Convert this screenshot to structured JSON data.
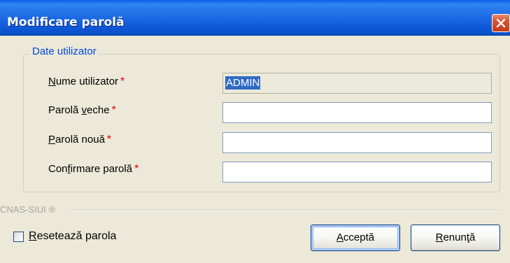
{
  "window": {
    "title": "Modificare parolă",
    "close_icon": "close-icon"
  },
  "group": {
    "legend": "Date utilizator",
    "fields": [
      {
        "label_first": "N",
        "label_rest": "ume utilizator",
        "required": "*",
        "value": "ADMIN"
      },
      {
        "label_pre": "Parolă ",
        "label_key": "v",
        "label_post": "eche",
        "required": "*",
        "value": ""
      },
      {
        "label_key": "P",
        "label_post": "arolă nouă",
        "required": "*",
        "value": ""
      },
      {
        "label_pre": "Con",
        "label_key": "f",
        "label_post": "irmare parolă",
        "required": "*",
        "value": ""
      }
    ]
  },
  "footer": {
    "brand": "CNAS-SIUI ®"
  },
  "reset": {
    "label_key": "R",
    "label_rest": "esetează parola",
    "checked": false
  },
  "buttons": {
    "accept": {
      "key": "A",
      "rest": "cceptă"
    },
    "cancel": {
      "key": "R",
      "rest": "enunţă"
    }
  },
  "colors": {
    "titlebar": "#0a5ee8",
    "legend": "#0046d5",
    "required": "#e00000",
    "selection": "#316ac5"
  }
}
